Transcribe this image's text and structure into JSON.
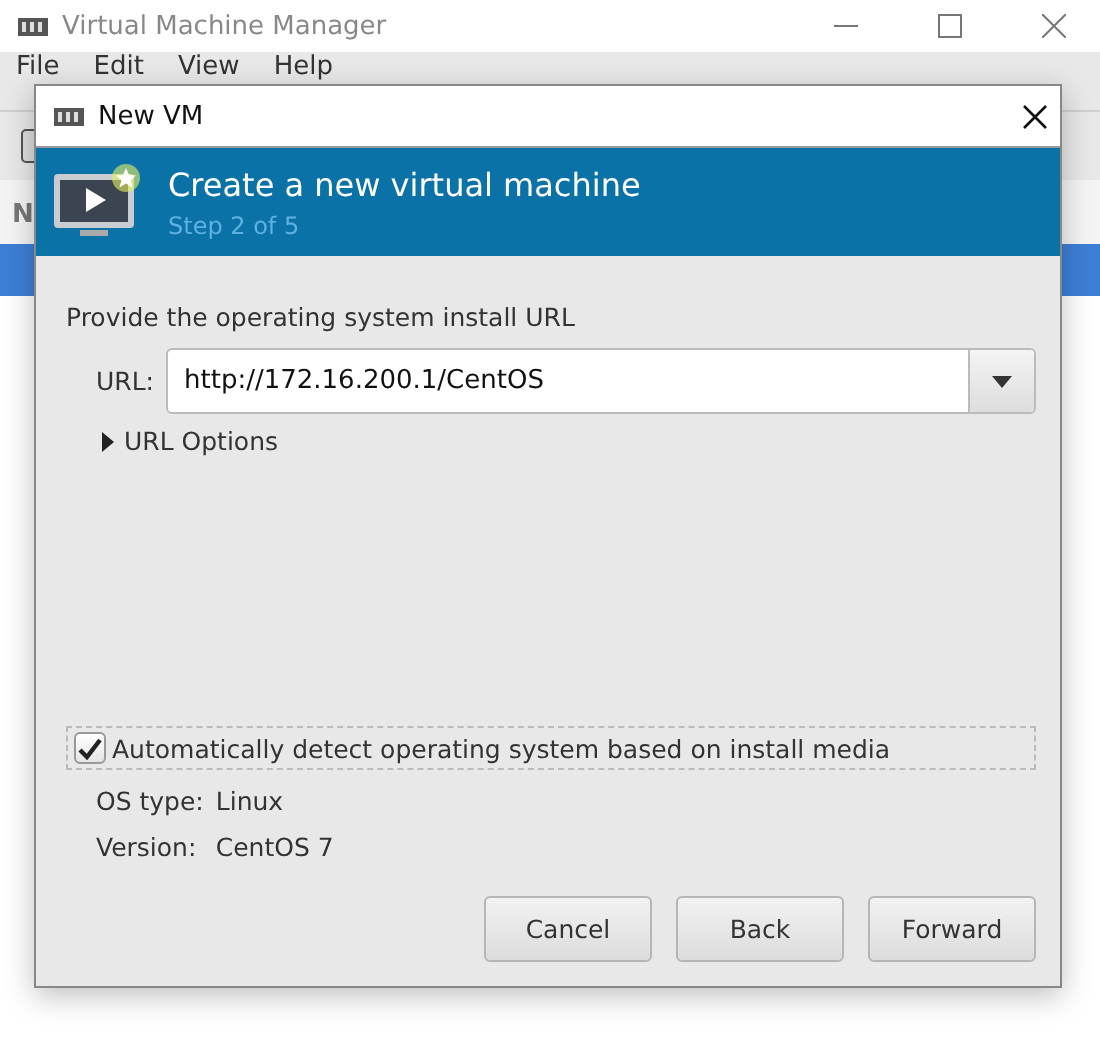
{
  "window": {
    "title": "Virtual Machine Manager"
  },
  "menu": [
    "File",
    "Edit",
    "View",
    "Help"
  ],
  "table": {
    "column_1": "N"
  },
  "dialog": {
    "title": "New VM",
    "heading": "Create a new virtual machine",
    "step": "Step 2 of 5",
    "prompt": "Provide the operating system install URL",
    "url": {
      "label": "URL:",
      "value": "http://172.16.200.1/CentOS"
    },
    "url_options": {
      "label": "URL Options",
      "expanded": false
    },
    "auto_detect": {
      "label": "Automatically detect operating system based on install media",
      "checked": true
    },
    "details": [
      {
        "label": "OS type:",
        "value": "Linux"
      },
      {
        "label": "Version:",
        "value": "CentOS 7"
      }
    ],
    "buttons": [
      "Cancel",
      "Back",
      "Forward"
    ]
  }
}
